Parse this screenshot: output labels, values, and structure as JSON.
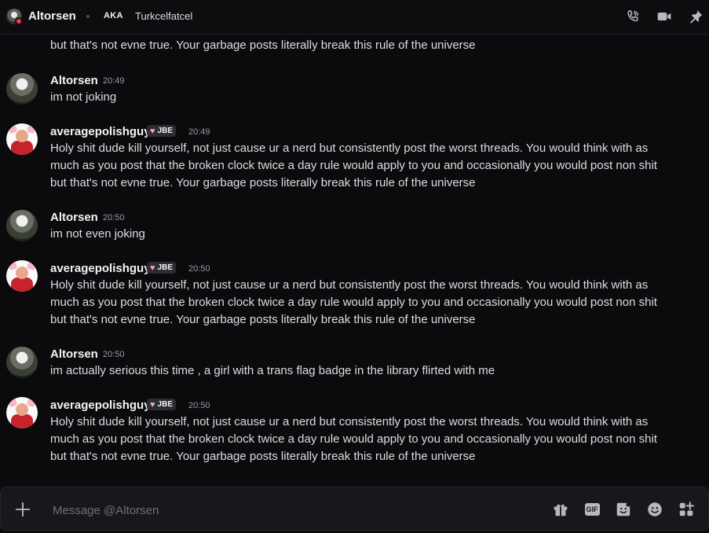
{
  "header": {
    "name": "Altorsen",
    "aka_label": "AKA",
    "aka_name": "Turkcelfatcel"
  },
  "messages": {
    "cutoff_line": "but that's not evne true. Your garbage posts literally break this rule of the universe",
    "m1": {
      "author": "Altorsen",
      "time": "20:49",
      "text": "im not joking"
    },
    "m2": {
      "author": "averagepolishguy",
      "badge": "JBE",
      "time": "20:49",
      "line1": "Holy shit dude kill yourself, not just cause ur a nerd but consistently post the worst threads. You would think with as",
      "line2": "much as you post that the broken clock twice a day rule would apply to you and occasionally you would post non shit",
      "line3": "but that's not evne true. Your garbage posts literally break this rule of the universe"
    },
    "m3": {
      "author": "Altorsen",
      "time": "20:50",
      "text": "im not even joking"
    },
    "m4": {
      "author": "averagepolishguy",
      "badge": "JBE",
      "time": "20:50",
      "line1": "Holy shit dude kill yourself, not just cause ur a nerd but consistently post the worst threads. You would think with as",
      "line2": "much as you post that the broken clock twice a day rule would apply to you and occasionally you would post non shit",
      "line3": "but that's not evne true. Your garbage posts literally break this rule of the universe"
    },
    "m5": {
      "author": "Altorsen",
      "time": "20:50",
      "text": "im actually serious this time , a girl with a trans flag badge in the library flirted with me"
    },
    "m6": {
      "author": "averagepolishguy",
      "badge": "JBE",
      "time": "20:50",
      "line1": "Holy shit dude kill yourself, not just cause ur a nerd but consistently post the worst threads. You would think with as",
      "line2": "much as you post that the broken clock twice a day rule would apply to you and occasionally you would post non shit",
      "line3": "but that's not evne true. Your garbage posts literally break this rule of the universe"
    }
  },
  "composer": {
    "placeholder": "Message @Altorsen",
    "gif_label": "GIF"
  }
}
